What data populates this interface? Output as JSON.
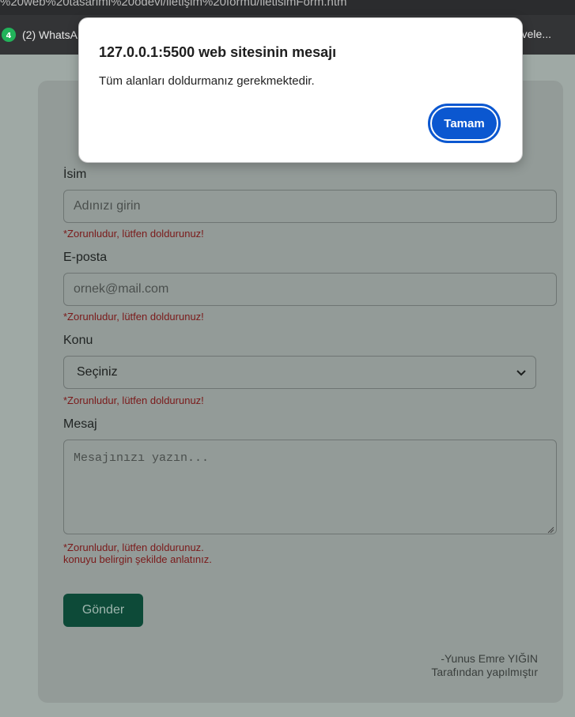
{
  "browser": {
    "url_fragment": "%20web%20tasarimi%20odevi/iletişim%20formu/iletisimForm.htm",
    "bookmark_label": "(2) WhatsA",
    "bookmark_right": "vele..."
  },
  "form": {
    "name_label": "İsim",
    "name_placeholder": "Adınızı girin",
    "name_error": "*Zorunludur, lütfen doldurunuz!",
    "email_label": "E-posta",
    "email_placeholder": "ornek@mail.com",
    "email_error": "*Zorunludur, lütfen doldurunuz!",
    "subject_label": "Konu",
    "subject_selected": "Seçiniz",
    "subject_error": "*Zorunludur, lütfen doldurunuz!",
    "message_label": "Mesaj",
    "message_placeholder": "Mesajınızı yazın...",
    "message_error_line1": "*Zorunludur, lütfen doldurunuz.",
    "message_error_line2": "konuyu belirgin şekilde anlatınız.",
    "submit_label": "Gönder"
  },
  "footer": {
    "author": "-Yunus Emre YIĞIN",
    "credit": "Tarafından yapılmıştır"
  },
  "dialog": {
    "title": "127.0.0.1:5500 web sitesinin mesajı",
    "message": "Tüm alanları doldurmanız gerekmektedir.",
    "ok_label": "Tamam"
  },
  "icons": {
    "bookmark_icon": "whatsapp-icon",
    "select_icon": "chevron-down-icon",
    "textarea_grip": "resize-grip-icon"
  },
  "colors": {
    "submit_bg": "#0d4a38",
    "error_text": "#7a1a1a",
    "dialog_button": "#0b57d0"
  }
}
